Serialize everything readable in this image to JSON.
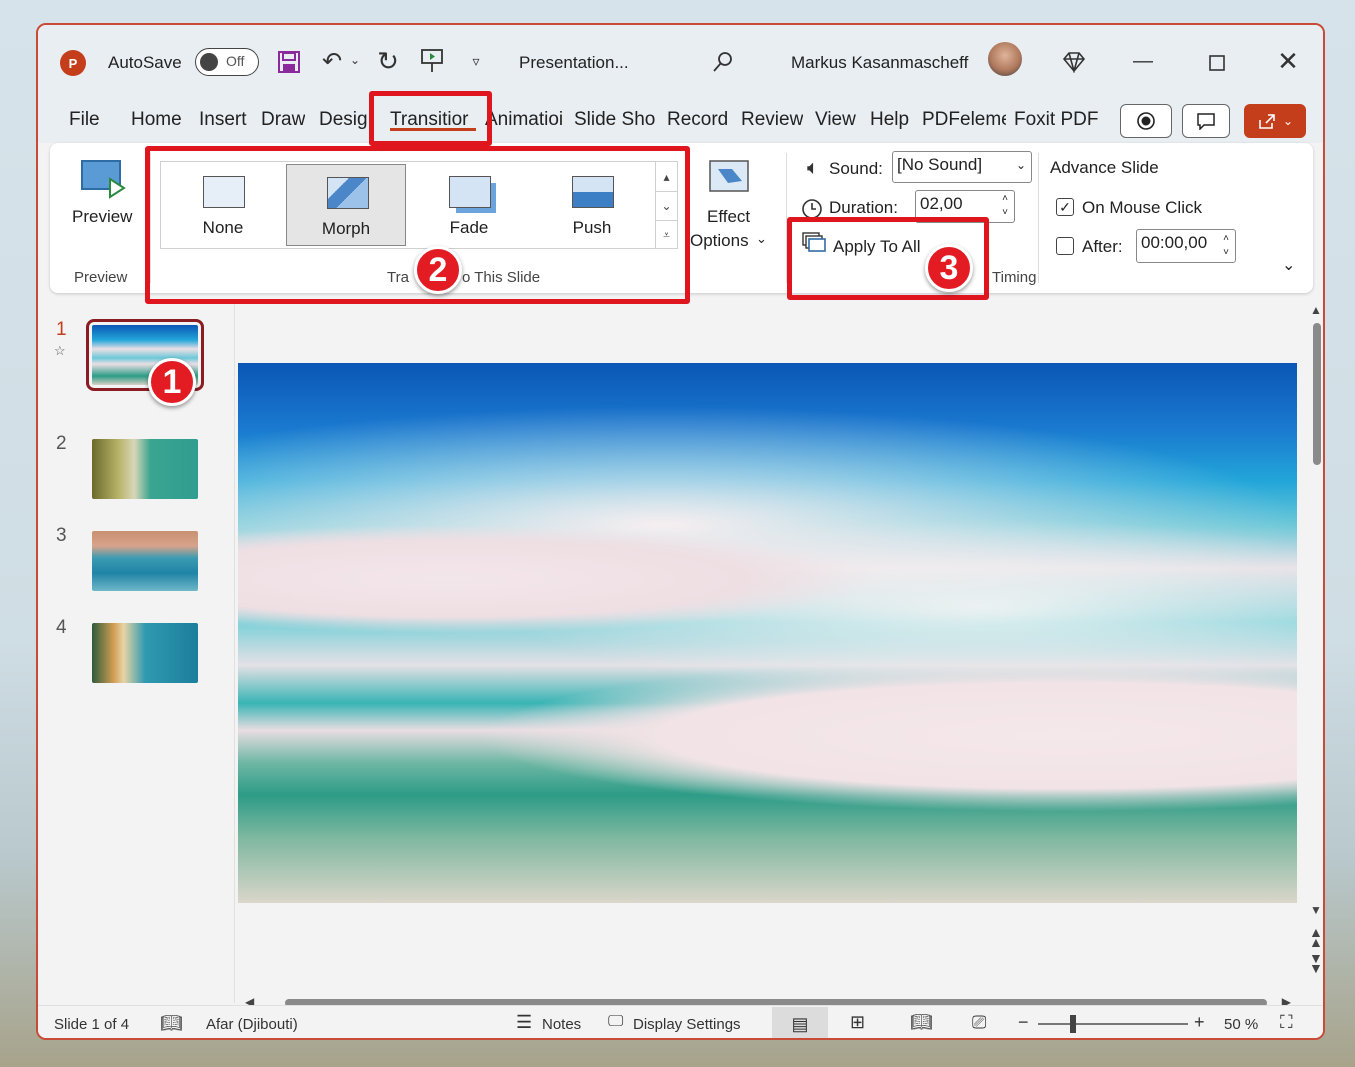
{
  "titlebar": {
    "autosave_label": "AutoSave",
    "autosave_state": "Off",
    "document_name": "Presentation...",
    "user_name": "Markus Kasanmascheff"
  },
  "tabs": [
    "File",
    "Home",
    "Insert",
    "Draw",
    "Design",
    "Transitions",
    "Animations",
    "Slide Show",
    "Record",
    "Review",
    "View",
    "Help",
    "PDFelement",
    "Foxit PDF"
  ],
  "tabs_visible": [
    "File",
    "Home",
    "Insert",
    "Draw",
    "Desig",
    "Transitior",
    "Animatioi",
    "Slide Sho",
    "Record",
    "Review",
    "View",
    "Help",
    "PDFeleme",
    "Foxit PDF"
  ],
  "ribbon": {
    "preview_label": "Preview",
    "preview_group": "Preview",
    "transitions": [
      "None",
      "Morph",
      "Fade",
      "Push"
    ],
    "selected_transition": "Morph",
    "transition_group": "Transition to This Slide",
    "transition_group_visible": "Tra",
    "transition_group_visible_tail": "o This Slide",
    "effect_options_line1": "Effect",
    "effect_options_line2": "Options",
    "sound_label": "Sound:",
    "sound_value": "[No Sound]",
    "duration_label": "Duration:",
    "duration_value": "02,00",
    "apply_to_all": "Apply To All",
    "advance_slide": "Advance Slide",
    "on_mouse_click": "On Mouse Click",
    "after_label": "After:",
    "after_value": "00:00,00",
    "timing_group": "Timing"
  },
  "slides": [
    {
      "number": "1"
    },
    {
      "number": "2"
    },
    {
      "number": "3"
    },
    {
      "number": "4"
    }
  ],
  "annotations": [
    "1",
    "2",
    "3"
  ],
  "statusbar": {
    "slide_info": "Slide 1 of 4",
    "language": "Afar (Djibouti)",
    "notes": "Notes",
    "display_settings": "Display Settings",
    "zoom": "50 %"
  },
  "colors": {
    "accent": "#c43e1c",
    "annotation_red": "#e0161f"
  }
}
